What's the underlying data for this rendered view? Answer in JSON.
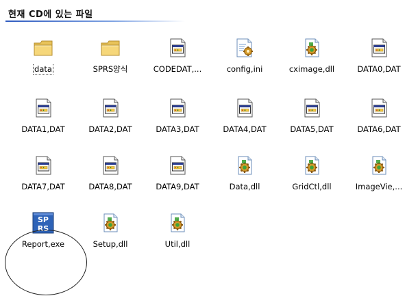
{
  "header": {
    "title": "현재 CD에 있는 파일"
  },
  "files": [
    {
      "name": "data",
      "icon": "folder-icon",
      "focused": true
    },
    {
      "name": "SPRS양식",
      "icon": "folder-icon"
    },
    {
      "name": "CODEDAT,...",
      "icon": "dat-file-icon"
    },
    {
      "name": "config,ini",
      "icon": "config-settings-icon"
    },
    {
      "name": "cximage,dll",
      "icon": "dll-gear-icon"
    },
    {
      "name": "DATA0,DAT",
      "icon": "dat-file-icon"
    },
    {
      "name": "DATA1,DAT",
      "icon": "dat-file-icon"
    },
    {
      "name": "DATA2,DAT",
      "icon": "dat-file-icon"
    },
    {
      "name": "DATA3,DAT",
      "icon": "dat-file-icon"
    },
    {
      "name": "DATA4,DAT",
      "icon": "dat-file-icon"
    },
    {
      "name": "DATA5,DAT",
      "icon": "dat-file-icon"
    },
    {
      "name": "DATA6,DAT",
      "icon": "dat-file-icon"
    },
    {
      "name": "DATA7,DAT",
      "icon": "dat-file-icon"
    },
    {
      "name": "DATA8,DAT",
      "icon": "dat-file-icon"
    },
    {
      "name": "DATA9,DAT",
      "icon": "dat-file-icon"
    },
    {
      "name": "Data,dll",
      "icon": "dll-gear-icon"
    },
    {
      "name": "GridCtl,dll",
      "icon": "dll-gear-icon"
    },
    {
      "name": "ImageVie,...",
      "icon": "dll-gear-icon"
    },
    {
      "name": "Report,exe",
      "icon": "sprs-app-icon",
      "highlighted": true
    },
    {
      "name": "Setup,dll",
      "icon": "dll-gear-icon"
    },
    {
      "name": "Util,dll",
      "icon": "dll-gear-icon"
    }
  ],
  "app_icon_text": {
    "top": "SP",
    "bottom": "RS"
  },
  "colors": {
    "header_rule": "#2f5bbf",
    "folder": "#f6d77a",
    "dll_gear": "#d49a2a",
    "dll_green": "#3fa33a",
    "app_icon": "#2e63b8"
  }
}
